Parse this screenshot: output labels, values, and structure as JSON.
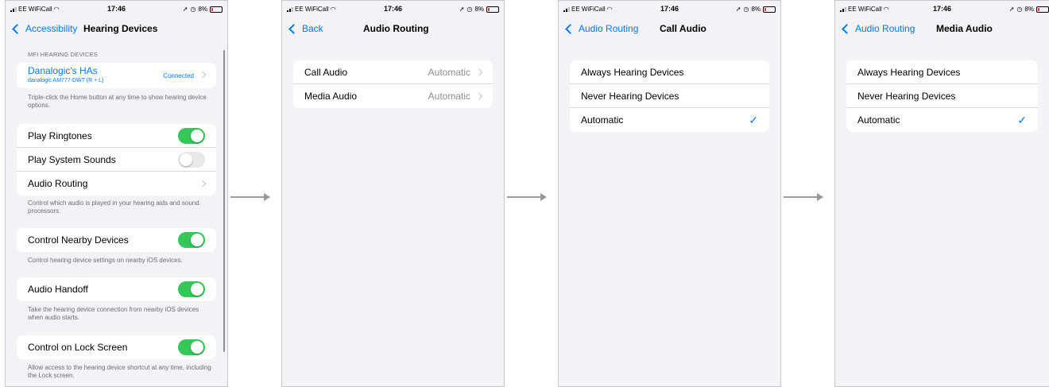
{
  "status_bar": {
    "carrier": "EE WiFiCall",
    "time": "17:46",
    "battery": "8%"
  },
  "screen1": {
    "back_label": "Accessibility",
    "title": "Hearing Devices",
    "mfi_header": "MFI HEARING DEVICES",
    "device_name": "Danalogic's HAs",
    "device_model": "danalogic AM777-DWT (R + L)",
    "device_status": "Connected",
    "device_footer": "Triple-click the Home button at any time to show hearing device options.",
    "rows": {
      "play_ringtones": "Play Ringtones",
      "play_system_sounds": "Play System Sounds",
      "audio_routing": "Audio Routing"
    },
    "routing_footer": "Control which audio is played in your hearing aids and sound processors.",
    "nearby_label": "Control Nearby Devices",
    "nearby_footer": "Control hearing device settings on nearby iOS devices.",
    "handoff_label": "Audio Handoff",
    "handoff_footer": "Take the hearing device connection from nearby iOS devices when audio starts.",
    "lock_label": "Control on Lock Screen",
    "lock_footer": "Allow access to the hearing device shortcut at any time, including the Lock screen.",
    "toggles": {
      "play_ringtones": true,
      "play_system_sounds": false,
      "nearby": true,
      "handoff": true,
      "lock": true
    }
  },
  "screen2": {
    "back_label": "Back",
    "title": "Audio Routing",
    "rows": [
      {
        "label": "Call Audio",
        "value": "Automatic"
      },
      {
        "label": "Media Audio",
        "value": "Automatic"
      }
    ]
  },
  "screen3": {
    "back_label": "Audio Routing",
    "title": "Call Audio",
    "options": [
      "Always Hearing Devices",
      "Never Hearing Devices",
      "Automatic"
    ],
    "selected": "Automatic"
  },
  "screen4": {
    "back_label": "Audio Routing",
    "title": "Media Audio",
    "options": [
      "Always Hearing Devices",
      "Never Hearing Devices",
      "Automatic"
    ],
    "selected": "Automatic"
  },
  "icons": {
    "check": "✓"
  },
  "colors": {
    "accent": "#007aff",
    "toggle_on": "#34c759",
    "background": "#f2f2f7"
  }
}
